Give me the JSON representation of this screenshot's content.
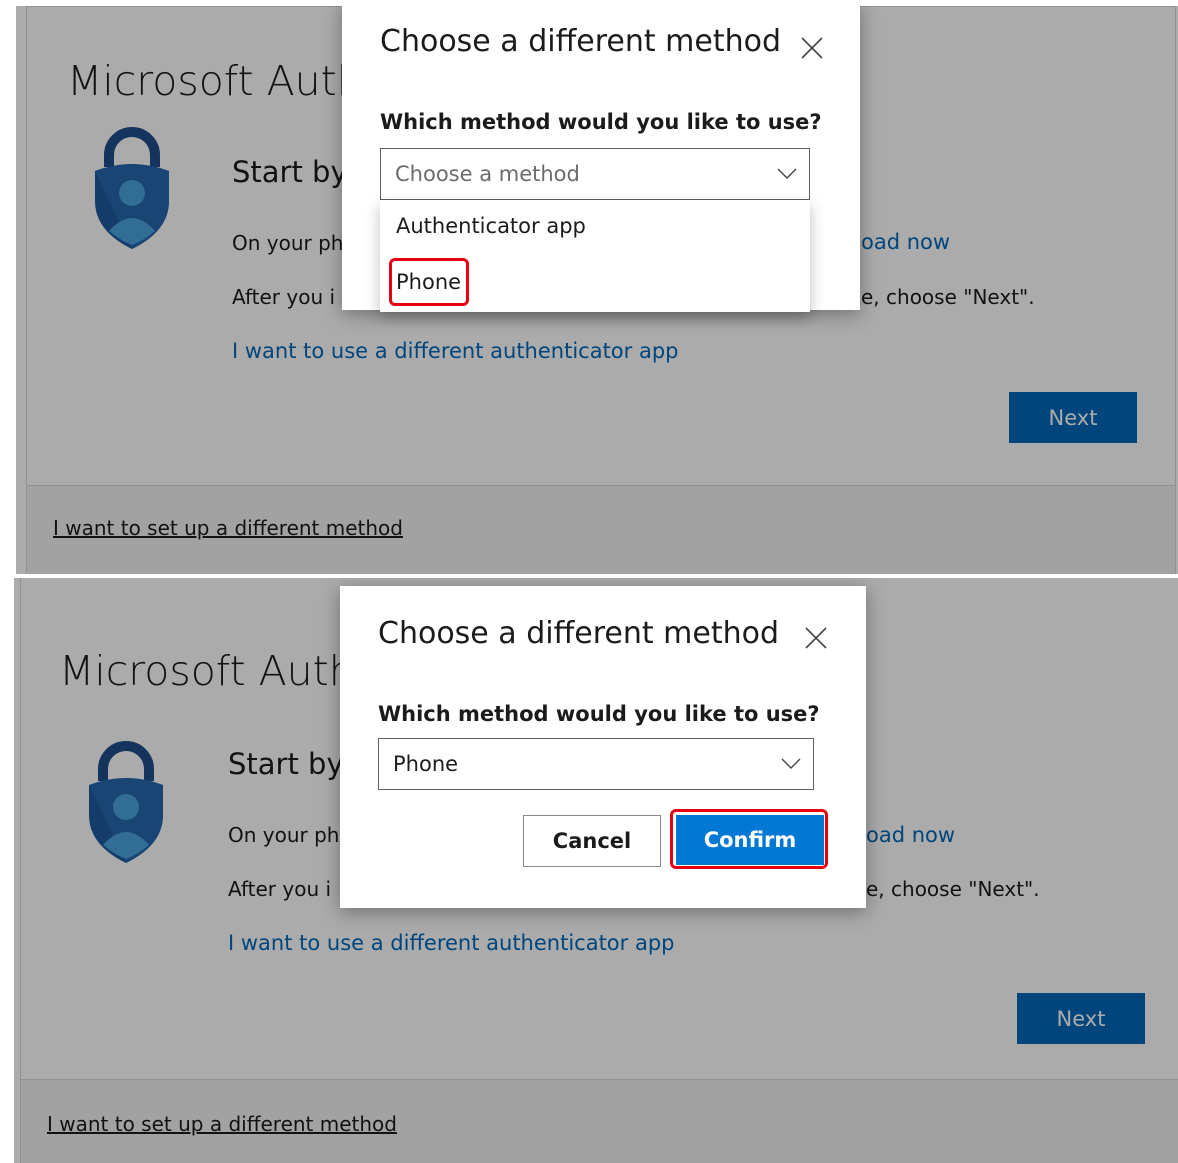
{
  "page": {
    "app_title": "Microsoft Auth",
    "start_heading": "Start by",
    "line1_prefix": "On your ph",
    "line1_link_tail": "oad now",
    "line2_prefix": "After you i",
    "line2_suffix": "e, choose \"Next\".",
    "alt_app_link": "I want to use a different authenticator app",
    "next_label": "Next",
    "different_method_link": "I want to set up a different method",
    "icon": "authenticator-lock-person-icon"
  },
  "dialog_top": {
    "title": "Choose a different method",
    "question": "Which method would you like to use?",
    "select_placeholder": "Choose a method",
    "options": [
      "Authenticator app",
      "Phone"
    ],
    "highlighted_option": "Phone"
  },
  "dialog_bottom": {
    "title": "Choose a different method",
    "question": "Which method would you like to use?",
    "select_value": "Phone",
    "cancel_label": "Cancel",
    "confirm_label": "Confirm",
    "highlighted_button": "Confirm"
  },
  "colors": {
    "accent": "#0067b8",
    "confirm": "#0078d4",
    "highlight": "#e60012"
  }
}
